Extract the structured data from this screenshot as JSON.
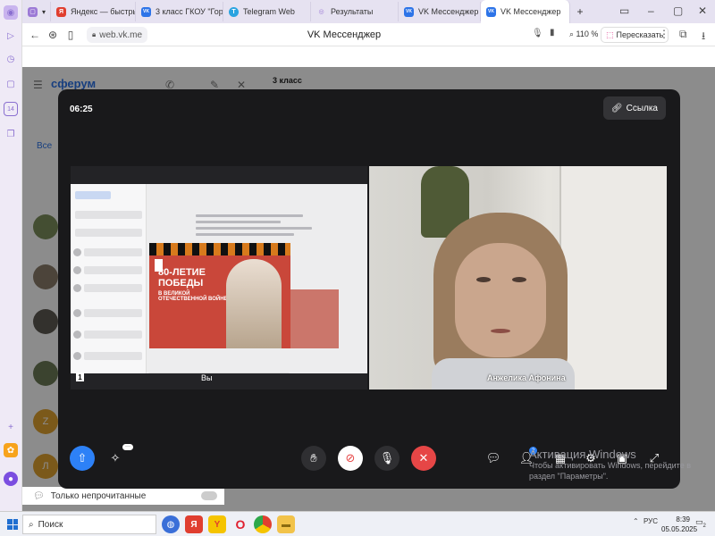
{
  "browser": {
    "tabs": [
      {
        "label": "Яндекс — быстрый пои",
        "favicon": "Я",
        "color": "#e03e2f"
      },
      {
        "label": "3 класс ГКОУ \"Горнов",
        "favicon": "VK",
        "color": "#2d74e8"
      },
      {
        "label": "Telegram Web",
        "favicon": "T",
        "color": "#2aa3e0"
      },
      {
        "label": "Результаты",
        "favicon": "◎",
        "color": "#9c7ad6"
      },
      {
        "label": "VK Мессенджер",
        "favicon": "VK",
        "color": "#2d74e8"
      },
      {
        "label": "VK Мессенджер",
        "favicon": "VK",
        "color": "#2d74e8",
        "active": true
      }
    ],
    "new_tab_symbol": "+",
    "url": "web.vk.me",
    "page_title": "VK Мессенджер",
    "zoom": "110 %",
    "resend_label": "Пересказать"
  },
  "vk": {
    "brand": "сферум",
    "filter_all": "Все",
    "chat_title": "3 класс",
    "unread_label": "Только непрочитанные",
    "avatar_letters": [
      "Z",
      "Л"
    ]
  },
  "call": {
    "timer": "06:25",
    "link_label": "Ссылка",
    "self_label": "Вы",
    "self_index": "1",
    "remote_name": "Анжелика Афонина",
    "poster_title": "80-ЛЕТИЕ ПОБЕДЫ",
    "poster_subtitle": "В ВЕЛИКОЙ ОТЕЧЕСТВЕННОЙ ВОЙНЕ",
    "participants_count": "2",
    "colors": {
      "share": "#2d81f7",
      "end": "#e64646",
      "camera_off": "#ffffff"
    }
  },
  "windows": {
    "activation_title": "Активация Windows",
    "activation_text": "Чтобы активировать Windows, перейдите в раздел \"Параметры\".",
    "search_label": "Поиск",
    "lang": "РУС",
    "time": "8:39",
    "date": "05.05.2025",
    "notification_count": "2"
  }
}
